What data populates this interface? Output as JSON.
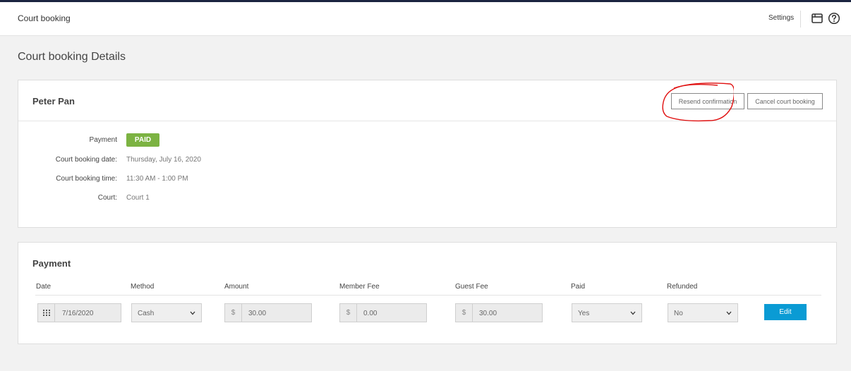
{
  "header": {
    "app_title": "Court booking",
    "settings_label": "Settings"
  },
  "page": {
    "title": "Court booking Details"
  },
  "booking": {
    "name": "Peter Pan",
    "actions": {
      "resend": "Resend confirmation",
      "cancel": "Cancel court booking"
    },
    "details": {
      "payment_label": "Payment",
      "payment_status": "PAID",
      "date_label": "Court booking date:",
      "date_value": "Thursday, July 16, 2020",
      "time_label": "Court booking time:",
      "time_value": "11:30 AM - 1:00 PM",
      "court_label": "Court:",
      "court_value": "Court 1"
    }
  },
  "payment": {
    "title": "Payment",
    "columns": {
      "date": "Date",
      "method": "Method",
      "amount": "Amount",
      "member_fee": "Member Fee",
      "guest_fee": "Guest Fee",
      "paid": "Paid",
      "refunded": "Refunded"
    },
    "row": {
      "date": "7/16/2020",
      "method": "Cash",
      "currency": "$",
      "amount": "30.00",
      "member_fee": "0.00",
      "guest_fee": "30.00",
      "paid": "Yes",
      "refunded": "No",
      "edit_label": "Edit"
    }
  },
  "colors": {
    "paid_badge": "#7cb342",
    "edit_button": "#0a9bd4",
    "annotation": "#e01010"
  }
}
